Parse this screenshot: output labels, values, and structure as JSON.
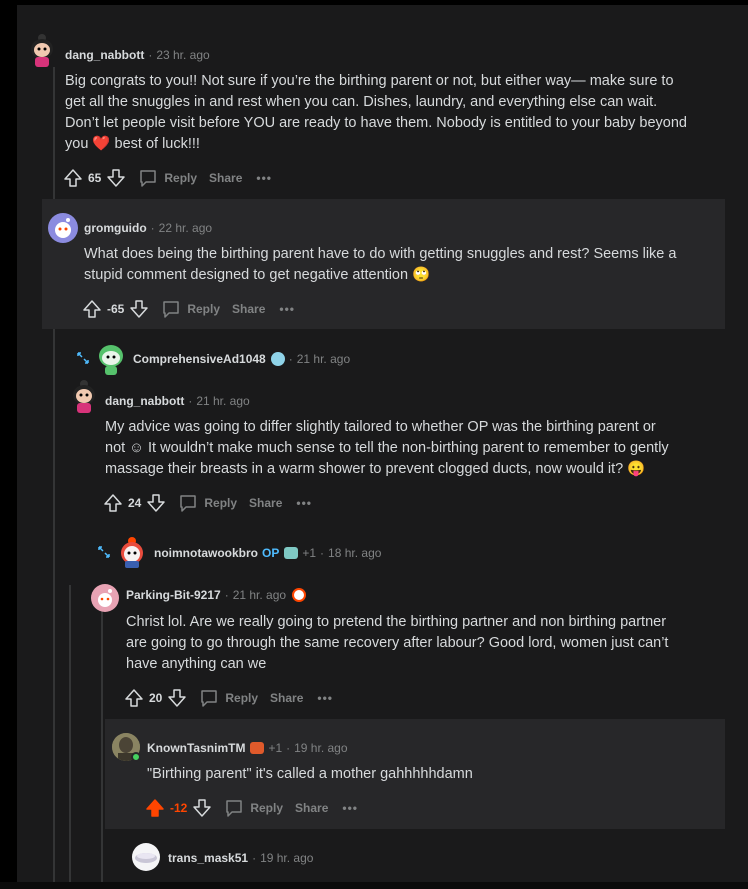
{
  "comments": {
    "c1": {
      "user": "dang_nabbott",
      "time": "23 hr. ago",
      "body_1": "Big congrats to you!! Not sure if you’re the birthing parent or not, but either way— make sure to",
      "body_2": "get all the snuggles in and rest when you can. Dishes, laundry, and everything else can wait.",
      "body_3": "Don’t let people visit before YOU are ready to have them. Nobody is entitled to your baby beyond",
      "body_4a": "you",
      "body_4b": "best of luck!!!",
      "score": "65"
    },
    "c2": {
      "user": "gromguido",
      "time": "22 hr. ago",
      "body_1": "What does being the birthing parent have to do with getting snuggles and rest? Seems like a",
      "body_2": "stupid comment designed to get negative attention",
      "score": "-65"
    },
    "c3": {
      "user": "ComprehensiveAd1048",
      "time": "21 hr. ago"
    },
    "c4": {
      "user": "dang_nabbott",
      "time": "21 hr. ago",
      "body_1": "My advice was going to differ slightly tailored to whether OP was the birthing parent or",
      "body_2": "not ☺ It wouldn’t make much sense to tell the non-birthing parent to remember to gently",
      "body_3": "massage their breasts in a warm shower to prevent clogged ducts, now would it?",
      "score": "24"
    },
    "c5": {
      "user": "noimnotawookbro",
      "op": "OP",
      "flair": "+1",
      "time": "18 hr. ago"
    },
    "c6": {
      "user": "Parking-Bit-9217",
      "time": "21 hr. ago",
      "body_1": "Christ lol. Are we really going to pretend the birthing partner and non birthing partner",
      "body_2": "are going to go through the same recovery after labour? Good lord, women just can’t",
      "body_3": "have anything can we",
      "score": "20"
    },
    "c7": {
      "user": "KnownTasnimTM",
      "flair": "+1",
      "time": "19 hr. ago",
      "body_1": "\"Birthing parent\" it's called a mother gahhhhhdamn",
      "score": "-12"
    },
    "c8": {
      "user": "trans_mask51",
      "time": "19 hr. ago"
    }
  },
  "labels": {
    "reply": "Reply",
    "share": "Share",
    "more": "•••",
    "sep": "·"
  },
  "colors": {
    "background": "#1a1a1b",
    "panel": "#272729",
    "upvoted": "#ff4500",
    "op": "#4fbcff"
  }
}
